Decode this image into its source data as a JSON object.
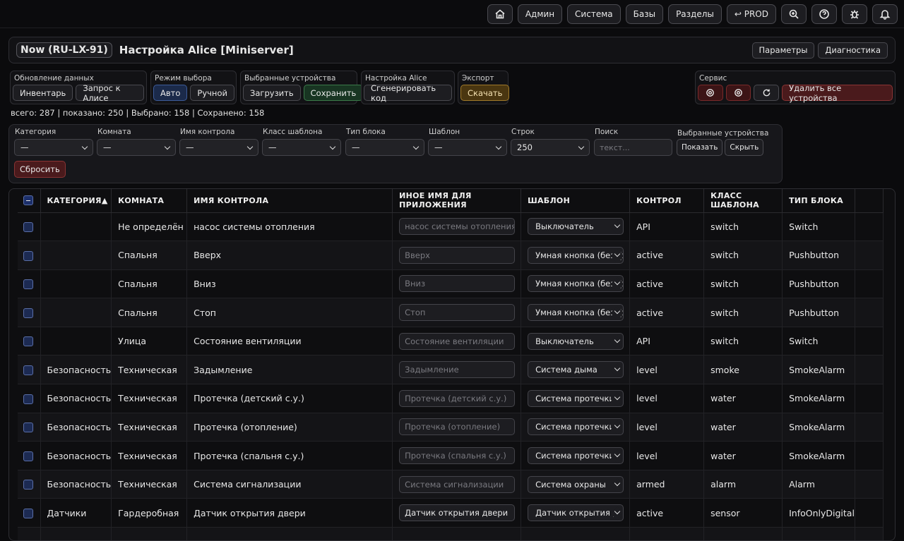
{
  "topnav": {
    "admin": "Админ",
    "system": "Система",
    "bases": "Базы",
    "sections": "Разделы",
    "prod": "↩ PROD"
  },
  "header": {
    "badge": "Now (RU-LX-91)",
    "title": "Настройка Alice [Miniserver]",
    "params": "Параметры",
    "diagnostics": "Диагностика"
  },
  "groups": {
    "refresh": {
      "label": "Обновление данных",
      "inventory": "Инвентарь",
      "query": "Запрос к Алисе"
    },
    "mode": {
      "label": "Режим выбора",
      "auto": "Авто",
      "manual": "Ручной"
    },
    "selected": {
      "label": "Выбранные устройства",
      "load": "Загрузить",
      "save": "Сохранить"
    },
    "alice": {
      "label": "Настройка Alice",
      "generate": "Сгенерировать код"
    },
    "export": {
      "label": "Экспорт",
      "download": "Скачать"
    },
    "service": {
      "label": "Сервис",
      "delete_all": "Удалить все устройства"
    }
  },
  "stats": "всего: 287 | показано: 250 | Выбрано: 158 | Сохранено: 158",
  "filters": {
    "category": {
      "label": "Категория",
      "value": "—"
    },
    "room": {
      "label": "Комната",
      "value": "—"
    },
    "control": {
      "label": "Имя контрола",
      "value": "—"
    },
    "tclass": {
      "label": "Класс шаблона",
      "value": "—"
    },
    "block": {
      "label": "Тип блока",
      "value": "—"
    },
    "template": {
      "label": "Шаблон",
      "value": "—"
    },
    "rows": {
      "label": "Строк",
      "value": "250"
    },
    "search": {
      "label": "Поиск",
      "placeholder": "текст..."
    },
    "selected": {
      "label": "Выбранные устройства",
      "show": "Показать",
      "hide": "Скрыть"
    },
    "reset": "Сбросить"
  },
  "table": {
    "headers": [
      "КАТЕГОРИЯ▲",
      "КОМНАТА",
      "ИМЯ КОНТРОЛА",
      "ИНОЕ ИМЯ ДЛЯ ПРИЛОЖЕНИЯ",
      "ШАБЛОН",
      "КОНТРОЛ",
      "КЛАСС ШАБЛОНА",
      "ТИП БЛОКА"
    ],
    "rows": [
      {
        "category": "",
        "room": "Не определён",
        "name": "насос системы отопления",
        "alt": "насос системы отопления",
        "alt_filled": false,
        "template": "Выключатель",
        "control": "API",
        "tclass": "switch",
        "block": "Switch"
      },
      {
        "category": "",
        "room": "Спальня",
        "name": "Вверх",
        "alt": "Вверх",
        "alt_filled": false,
        "template": "Умная кнопка (без фи",
        "control": "active",
        "tclass": "switch",
        "block": "Pushbutton"
      },
      {
        "category": "",
        "room": "Спальня",
        "name": "Вниз",
        "alt": "Вниз",
        "alt_filled": false,
        "template": "Умная кнопка (без фи",
        "control": "active",
        "tclass": "switch",
        "block": "Pushbutton"
      },
      {
        "category": "",
        "room": "Спальня",
        "name": "Стоп",
        "alt": "Стоп",
        "alt_filled": false,
        "template": "Умная кнопка (без фи",
        "control": "active",
        "tclass": "switch",
        "block": "Pushbutton"
      },
      {
        "category": "",
        "room": "Улица",
        "name": "Состояние вентиляции",
        "alt": "Состояние вентиляции",
        "alt_filled": false,
        "template": "Выключатель",
        "control": "API",
        "tclass": "switch",
        "block": "Switch"
      },
      {
        "category": "Безопасность",
        "room": "Техническая",
        "name": "Задымление",
        "alt": "Задымление",
        "alt_filled": false,
        "template": "Система дыма",
        "control": "level",
        "tclass": "smoke",
        "block": "SmokeAlarm"
      },
      {
        "category": "Безопасность",
        "room": "Техническая",
        "name": "Протечка (детский с.у.)",
        "alt": "Протечка (детский с.у.)",
        "alt_filled": false,
        "template": "Система протечки",
        "control": "level",
        "tclass": "water",
        "block": "SmokeAlarm"
      },
      {
        "category": "Безопасность",
        "room": "Техническая",
        "name": "Протечка (отопление)",
        "alt": "Протечка (отопление)",
        "alt_filled": false,
        "template": "Система протечки",
        "control": "level",
        "tclass": "water",
        "block": "SmokeAlarm"
      },
      {
        "category": "Безопасность",
        "room": "Техническая",
        "name": "Протечка (спальня с.у.)",
        "alt": "Протечка (спальня с.у.)",
        "alt_filled": false,
        "template": "Система протечки",
        "control": "level",
        "tclass": "water",
        "block": "SmokeAlarm"
      },
      {
        "category": "Безопасность",
        "room": "Техническая",
        "name": "Система сигнализации",
        "alt": "Система сигнализации",
        "alt_filled": false,
        "template": "Система охраны",
        "control": "armed",
        "tclass": "alarm",
        "block": "Alarm"
      },
      {
        "category": "Датчики",
        "room": "Гардеробная",
        "name": "Датчик открытия двери",
        "alt": "Датчик открытия двери",
        "alt_filled": true,
        "template": "Датчик открытия двер",
        "control": "active",
        "tclass": "sensor",
        "block": "InfoOnlyDigital"
      },
      {
        "category": "",
        "room": "",
        "name": "",
        "alt": "",
        "alt_filled": false,
        "template": "",
        "control": "",
        "tclass": "",
        "block": ""
      }
    ]
  }
}
